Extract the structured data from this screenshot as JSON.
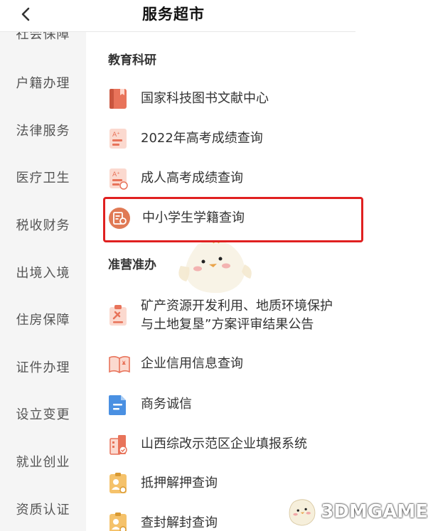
{
  "header": {
    "title": "服务超市",
    "back_icon": "chevron-left-icon"
  },
  "sidebar": {
    "items": [
      {
        "label": "社会保障"
      },
      {
        "label": "户籍办理"
      },
      {
        "label": "法律服务"
      },
      {
        "label": "医疗卫生"
      },
      {
        "label": "税收财务"
      },
      {
        "label": "出境入境"
      },
      {
        "label": "住房保障"
      },
      {
        "label": "证件办理"
      },
      {
        "label": "设立变更"
      },
      {
        "label": "就业创业"
      },
      {
        "label": "资质认证"
      }
    ]
  },
  "sections": [
    {
      "title": "教育科研",
      "items": [
        {
          "label": "国家科技图书文献中心",
          "icon": "library-book-icon"
        },
        {
          "label": "2022年高考成绩查询",
          "icon": "exam-score-icon"
        },
        {
          "label": "成人高考成绩查询",
          "icon": "adult-exam-score-icon"
        },
        {
          "label": "中小学生学籍查询",
          "icon": "student-record-icon",
          "highlighted": true
        }
      ]
    },
    {
      "title": "准营准办",
      "items": [
        {
          "label_line1": "矿产资源开发利用、地质环境保护",
          "label_line2": "与土地复垦”方案评审结果公告",
          "icon": "mining-report-icon"
        },
        {
          "label": "企业信用信息查询",
          "icon": "open-book-icon"
        },
        {
          "label": "商务诚信",
          "icon": "document-icon"
        },
        {
          "label": "山西综改示范区企业填报系统",
          "icon": "building-check-icon"
        },
        {
          "label": "抵押解押查询",
          "icon": "id-card-icon"
        },
        {
          "label": "查封解封查询",
          "icon": "id-card-icon"
        }
      ]
    }
  ],
  "watermark": {
    "text": "3DMGAME"
  },
  "colors": {
    "accent": "#e8735a",
    "highlight_border": "#e02020",
    "sidebar_bg": "#f5f5f5"
  }
}
